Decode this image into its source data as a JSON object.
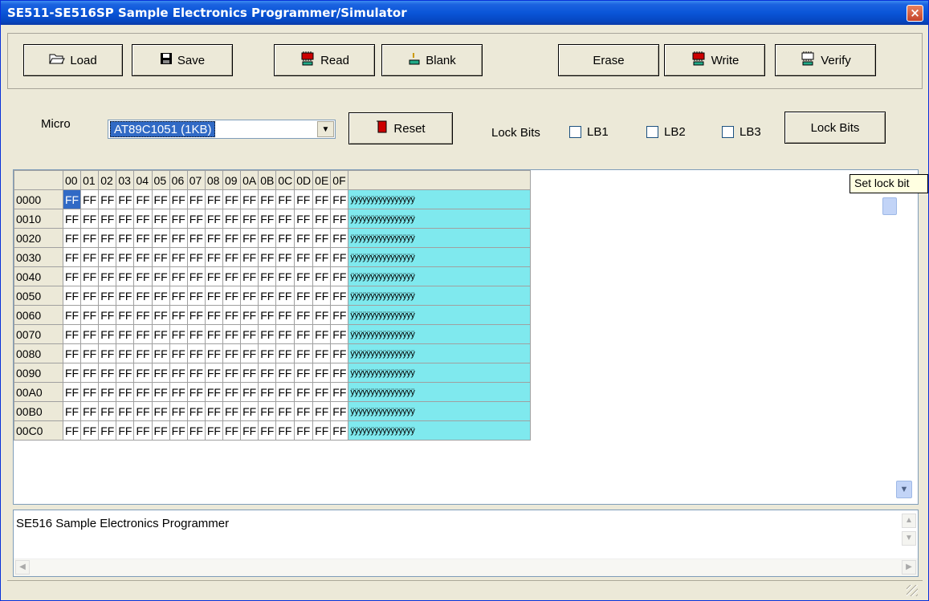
{
  "window": {
    "title": "SE511-SE516SP Sample Electronics Programmer/Simulator",
    "close_glyph": "×"
  },
  "toolbar": {
    "load": {
      "label": "Load",
      "icon": "folder-open-icon"
    },
    "save": {
      "label": "Save",
      "icon": "floppy-disk-icon"
    },
    "read": {
      "label": "Read",
      "icon": "chip-read-icon"
    },
    "blank": {
      "label": "Blank",
      "icon": "chip-blank-icon"
    },
    "erase": {
      "label": "Erase"
    },
    "write": {
      "label": "Write",
      "icon": "chip-write-icon"
    },
    "verify": {
      "label": "Verify",
      "icon": "chip-verify-icon"
    }
  },
  "settings": {
    "micro_label": "Micro",
    "micro_value": "AT89C1051 (1KB)",
    "reset_label": "Reset",
    "lockbits_label": "Lock Bits",
    "lb1": "LB1",
    "lb2": "LB2",
    "lb3": "LB3",
    "lockbits_button": "Lock Bits"
  },
  "tooltip": "Set lock bit",
  "hexgrid": {
    "columns": [
      "00",
      "01",
      "02",
      "03",
      "04",
      "05",
      "06",
      "07",
      "08",
      "09",
      "0A",
      "0B",
      "0C",
      "0D",
      "0E",
      "0F"
    ],
    "rows": [
      "0000",
      "0010",
      "0020",
      "0030",
      "0040",
      "0050",
      "0060",
      "0070",
      "0080",
      "0090",
      "00A0",
      "00B0",
      "00C0"
    ],
    "byte_value": "FF",
    "ascii_value": "ÿÿÿÿÿÿÿÿÿÿÿÿÿÿÿÿ",
    "selected_cell": {
      "row": "0000",
      "col": "00"
    },
    "colors": {
      "ascii_bg": "#7fe9ee",
      "selection": "#316ac5"
    }
  },
  "log": {
    "text": "SE516 Sample Electronics Programmer"
  }
}
